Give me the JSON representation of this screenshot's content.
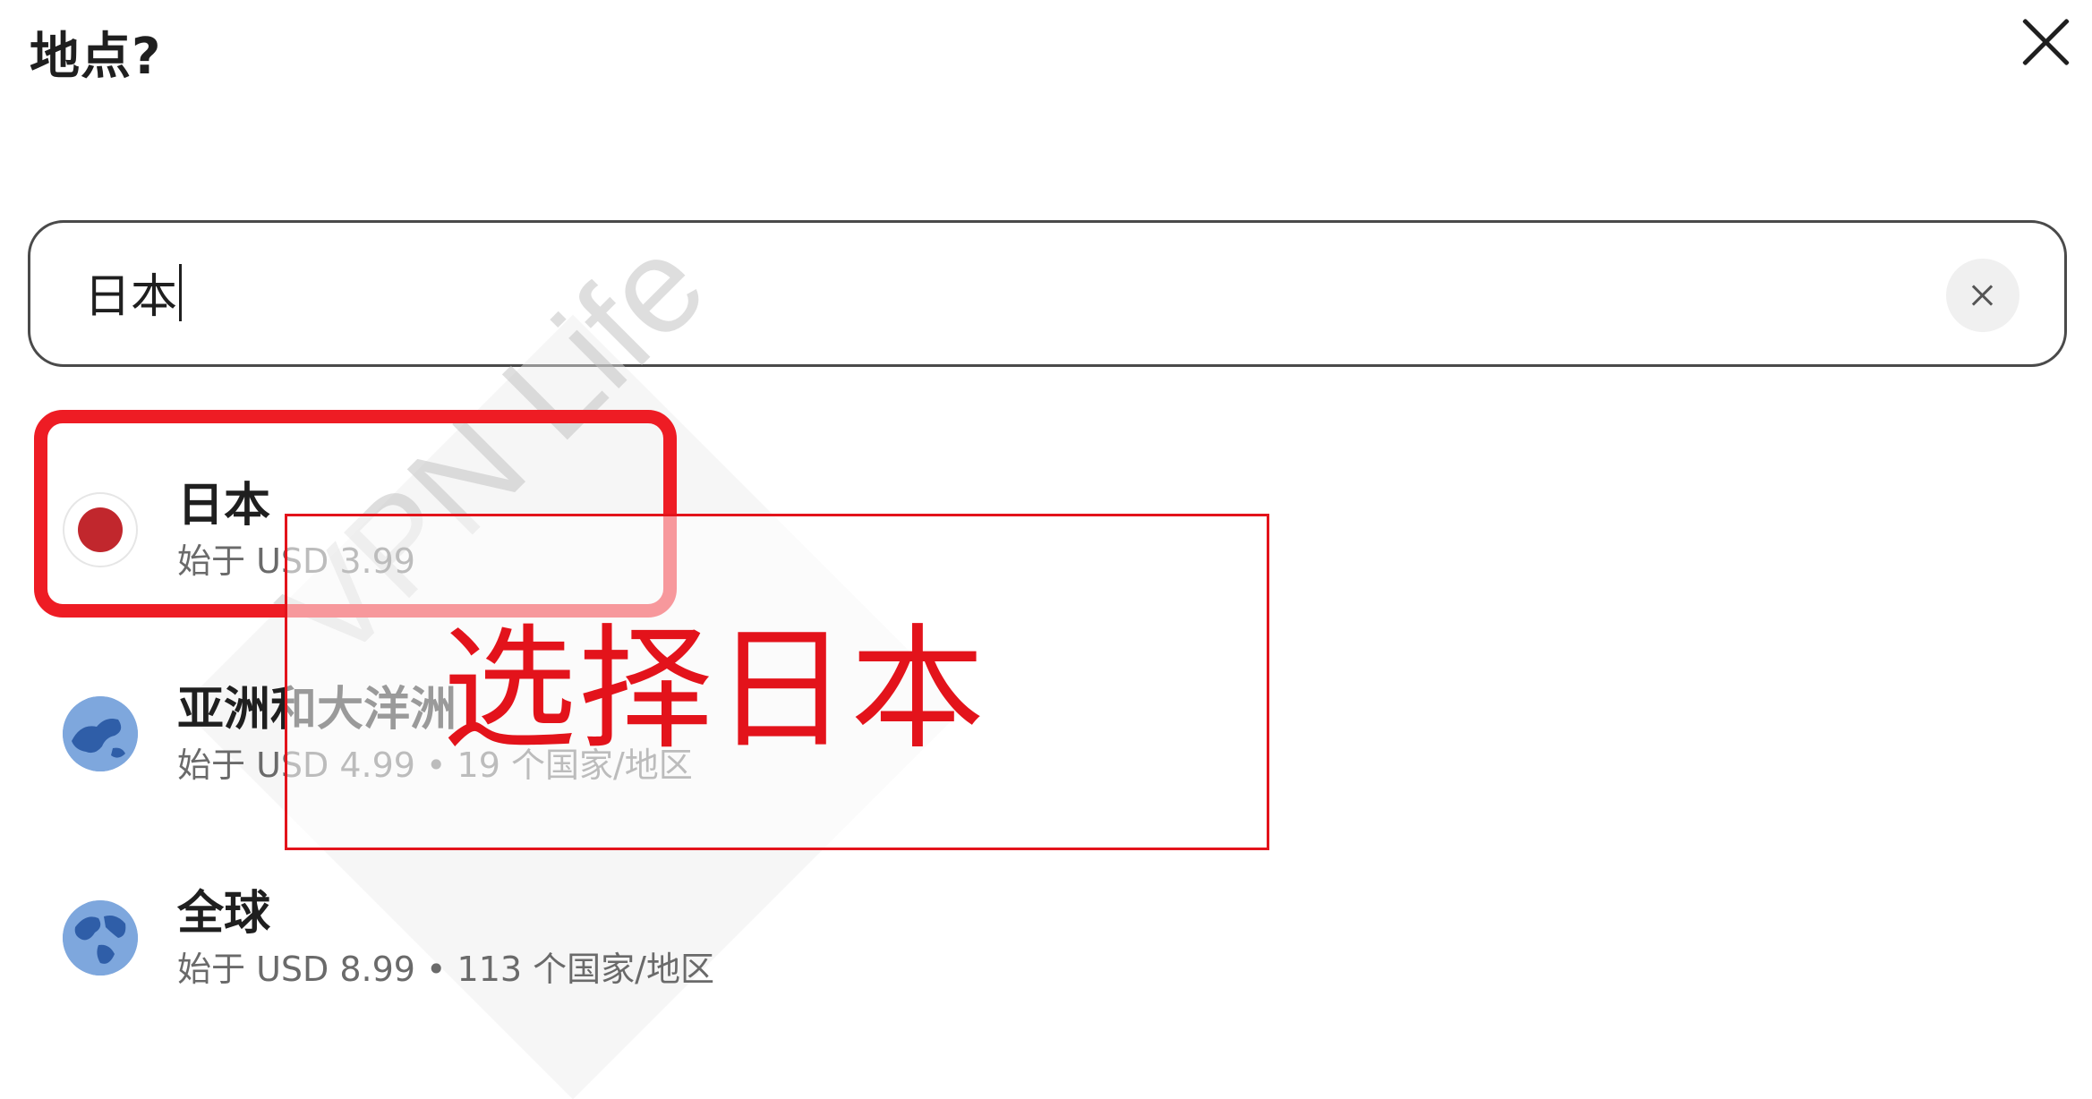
{
  "header": {
    "title": "地点?"
  },
  "search": {
    "value": "日本"
  },
  "results": [
    {
      "name": "日本",
      "subtitle": "始于 USD 3.99",
      "icon": "japan-flag-icon"
    },
    {
      "name": "亚洲和大洋洲",
      "subtitle": "始于 USD 4.99 • 19 个国家/地区",
      "icon": "globe-icon"
    },
    {
      "name": "全球",
      "subtitle": "始于 USD 8.99 • 113 个国家/地区",
      "icon": "globe-icon"
    }
  ],
  "watermark": "VPN Life",
  "annotation": {
    "text": "选择日本",
    "color": "#e3131b"
  },
  "colors": {
    "japan_red": "#c1272d",
    "highlight_red": "#ee1c24",
    "globe_blue": "#6f9bd6"
  }
}
